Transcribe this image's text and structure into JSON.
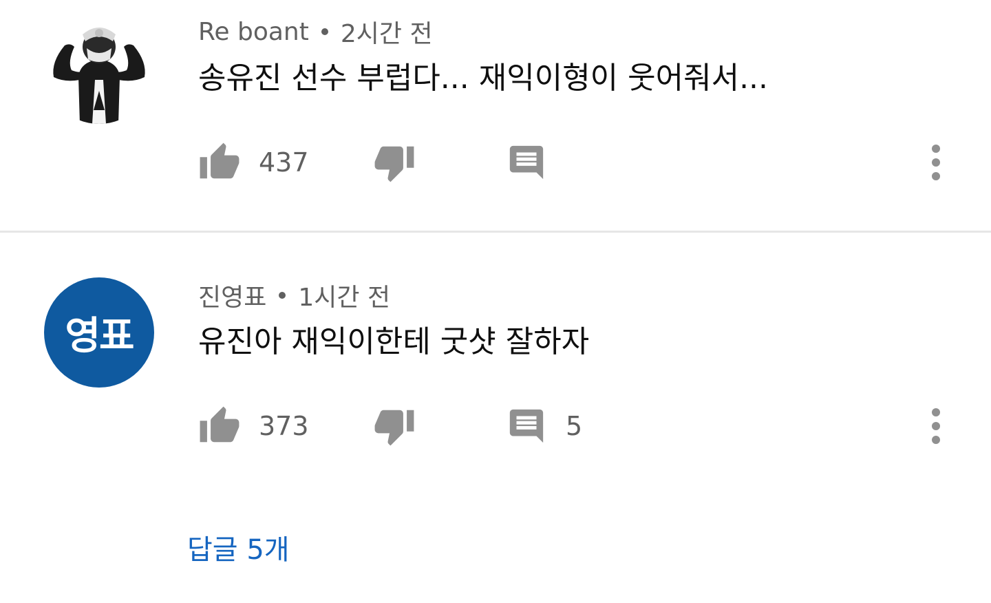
{
  "comments": [
    {
      "author": "Re boant",
      "time": "2시간 전",
      "text": "송유진 선수 부럽다... 재익이형이 웃어줘서...",
      "likes": "437",
      "reply_count": "",
      "avatar_icon": "hooded-figure-avatar"
    },
    {
      "author": "진영표",
      "time": "1시간 전",
      "text": "유진아 재익이한테 굿샷 잘하자",
      "likes": "373",
      "reply_count": "5",
      "avatar_initials": "영표",
      "avatar_color": "#0f5aa0"
    }
  ],
  "replies_link": "답글 5개",
  "colors": {
    "icon_gray": "#909090",
    "meta_gray": "#606060",
    "link_blue": "#1565c0",
    "divider": "#e6e6e6"
  }
}
